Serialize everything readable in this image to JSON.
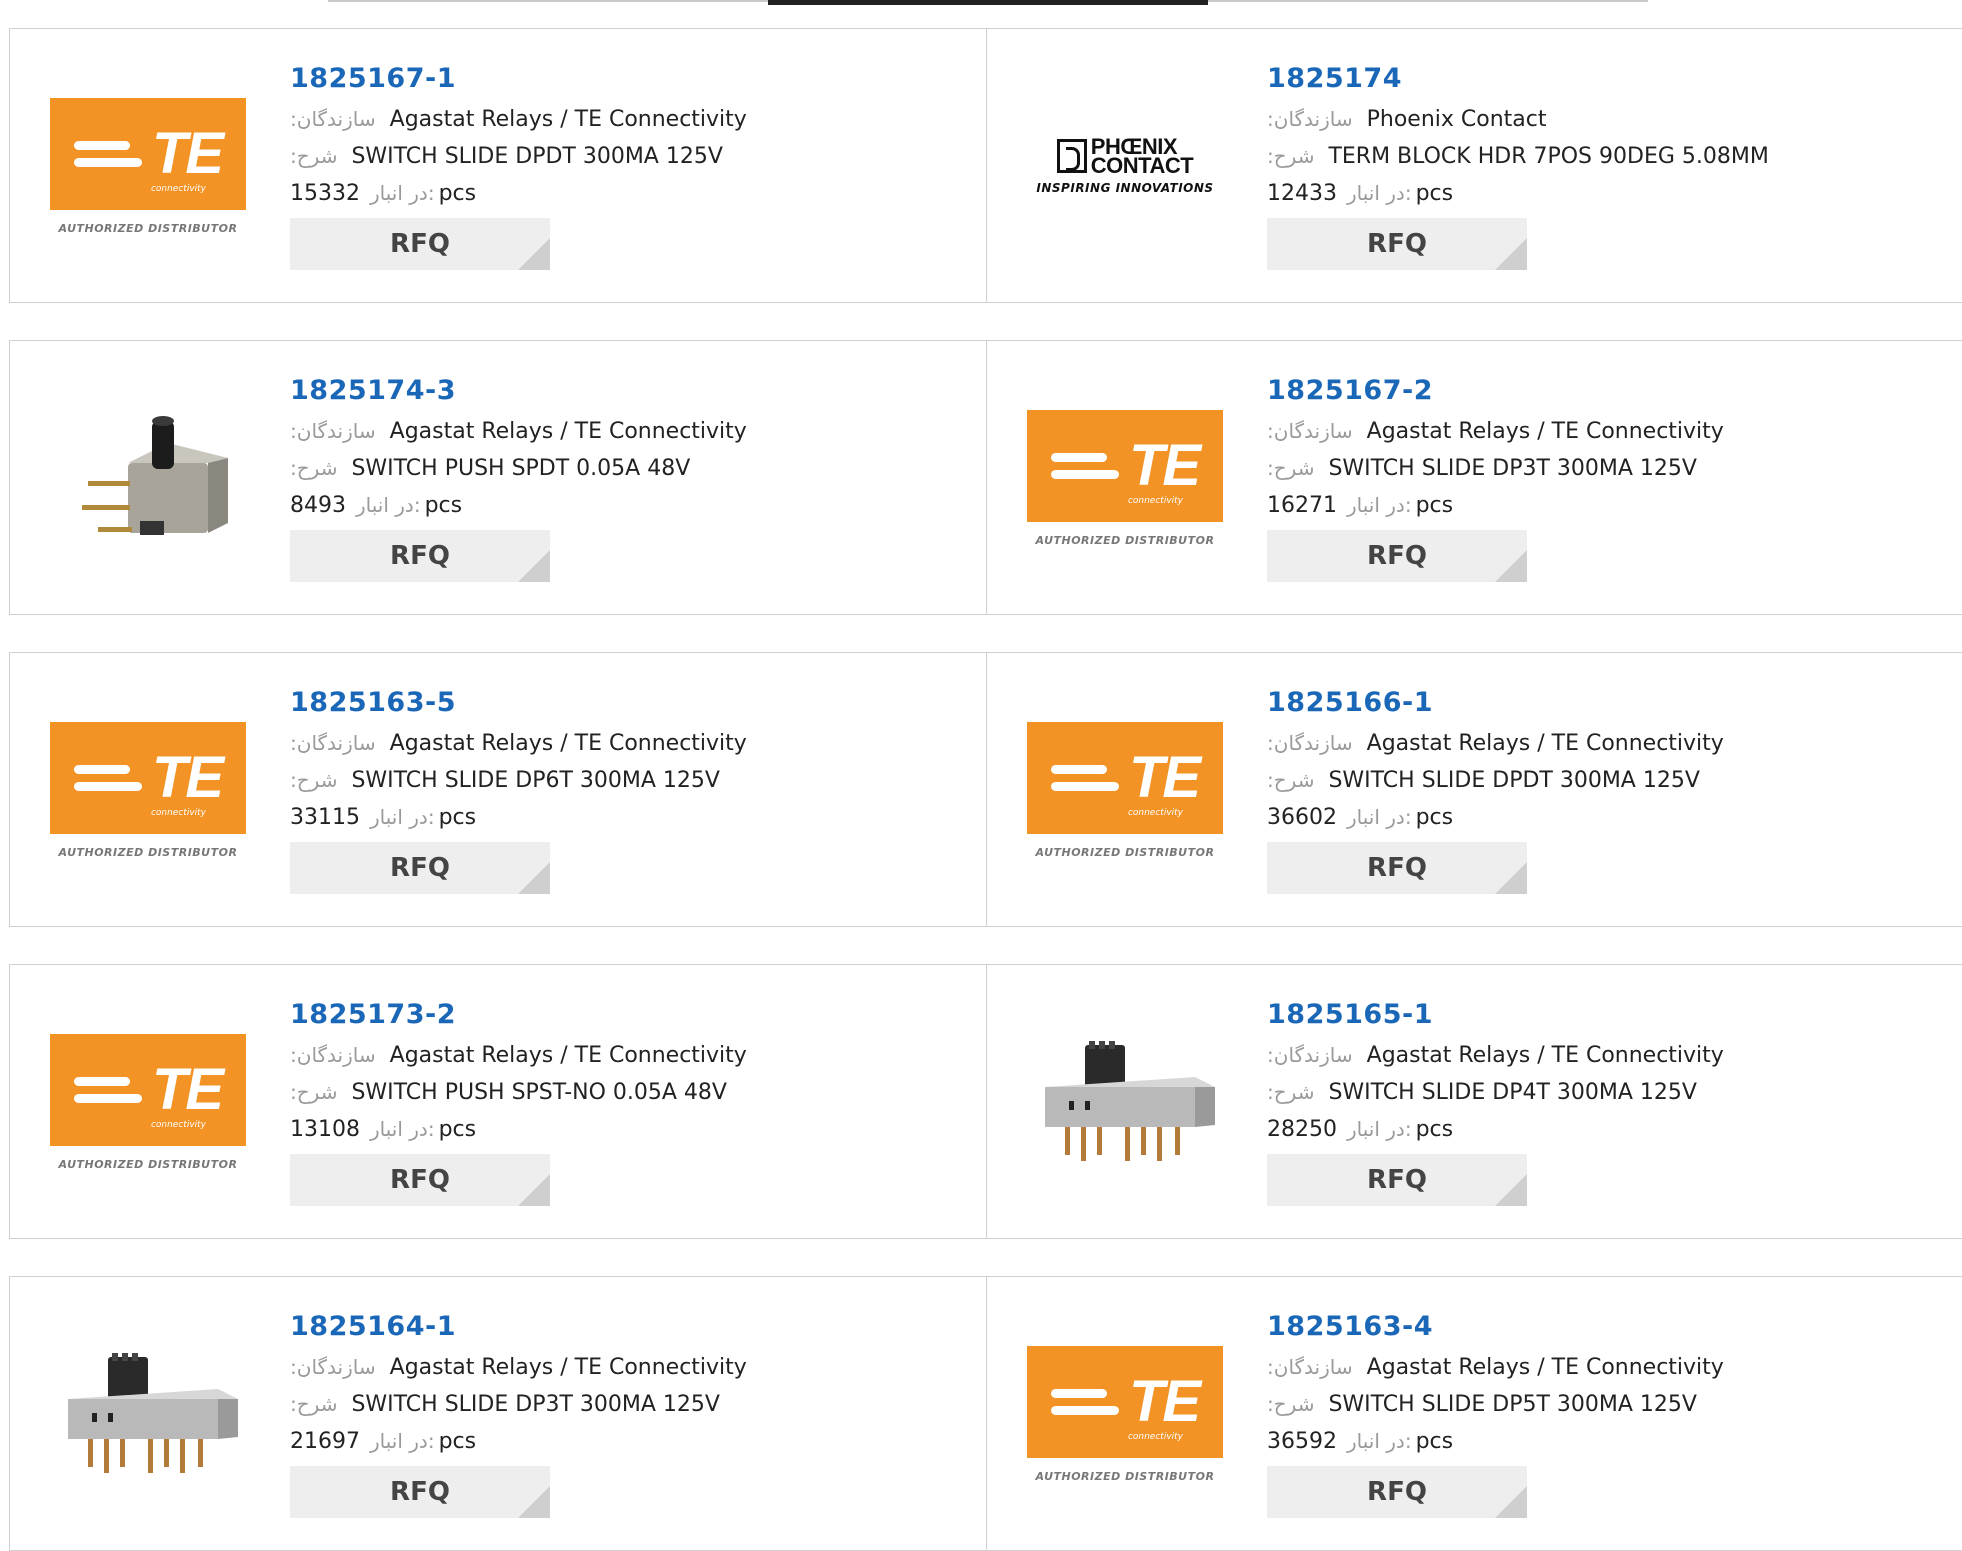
{
  "labels": {
    "manufacturer": ":سازندگان",
    "description": ":شرح",
    "stock": "در انبار:",
    "unit": "pcs",
    "rfq": "RFQ"
  },
  "logos": {
    "te_text": "TE",
    "te_sub": "connectivity",
    "te_auth": "AUTHORIZED DISTRIBUTOR",
    "px_line1": "PHŒNIX",
    "px_line2": "CONTACT",
    "px_tag": "INSPIRING INNOVATIONS"
  },
  "products": [
    {
      "pn": "1825167-1",
      "mfr": "Agastat Relays / TE Connectivity",
      "desc": "SWITCH SLIDE DPDT 300MA 125V",
      "stock": "15332",
      "image": "te-logo"
    },
    {
      "pn": "1825174",
      "mfr": "Phoenix Contact",
      "desc": "TERM BLOCK HDR 7POS 90DEG 5.08MM",
      "stock": "12433",
      "image": "phoenix-logo"
    },
    {
      "pn": "1825174-3",
      "mfr": "Agastat Relays / TE Connectivity",
      "desc": "SWITCH PUSH SPDT 0.05A 48V",
      "stock": "8493",
      "image": "push-switch-photo"
    },
    {
      "pn": "1825167-2",
      "mfr": "Agastat Relays / TE Connectivity",
      "desc": "SWITCH SLIDE DP3T 300MA 125V",
      "stock": "16271",
      "image": "te-logo"
    },
    {
      "pn": "1825163-5",
      "mfr": "Agastat Relays / TE Connectivity",
      "desc": "SWITCH SLIDE DP6T 300MA 125V",
      "stock": "33115",
      "image": "te-logo"
    },
    {
      "pn": "1825166-1",
      "mfr": "Agastat Relays / TE Connectivity",
      "desc": "SWITCH SLIDE DPDT 300MA 125V",
      "stock": "36602",
      "image": "te-logo"
    },
    {
      "pn": "1825173-2",
      "mfr": "Agastat Relays / TE Connectivity",
      "desc": "SWITCH PUSH SPST-NO 0.05A 48V",
      "stock": "13108",
      "image": "te-logo"
    },
    {
      "pn": "1825165-1",
      "mfr": "Agastat Relays / TE Connectivity",
      "desc": "SWITCH SLIDE DP4T 300MA 125V",
      "stock": "28250",
      "image": "slide-switch-photo"
    },
    {
      "pn": "1825164-1",
      "mfr": "Agastat Relays / TE Connectivity",
      "desc": "SWITCH SLIDE DP3T 300MA 125V",
      "stock": "21697",
      "image": "slide-switch-photo"
    },
    {
      "pn": "1825163-4",
      "mfr": "Agastat Relays / TE Connectivity",
      "desc": "SWITCH SLIDE DP5T 300MA 125V",
      "stock": "36592",
      "image": "te-logo"
    }
  ]
}
